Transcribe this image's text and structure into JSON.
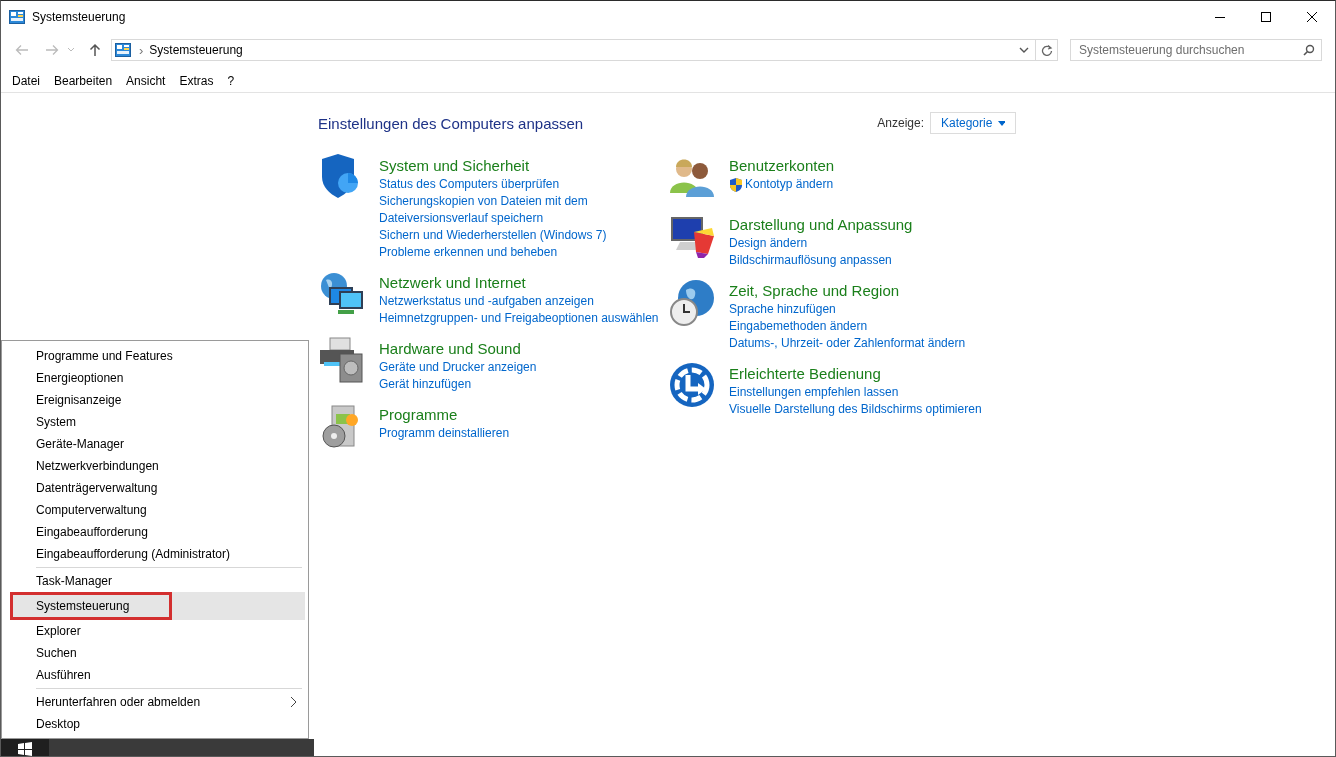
{
  "window": {
    "title": "Systemsteuerung"
  },
  "address_bar": {
    "path": "Systemsteuerung",
    "separator": "›"
  },
  "search": {
    "placeholder": "Systemsteuerung durchsuchen"
  },
  "menu_bar": [
    "Datei",
    "Bearbeiten",
    "Ansicht",
    "Extras",
    "?"
  ],
  "heading": "Einstellungen des Computers anpassen",
  "view": {
    "label": "Anzeige:",
    "value": "Kategorie"
  },
  "columns": [
    [
      {
        "kind": "shield",
        "title": "System und Sicherheit",
        "links": [
          {
            "text": "Status des Computers überprüfen",
            "kind": "plain"
          },
          {
            "text": "Sicherungskopien von Dateien mit dem Dateiversionsverlauf speichern",
            "kind": "plain"
          },
          {
            "text": "Sichern und Wiederherstellen (Windows 7)",
            "kind": "plain"
          },
          {
            "text": "Probleme erkennen und beheben",
            "kind": "plain"
          }
        ]
      },
      {
        "kind": "network",
        "title": "Netzwerk und Internet",
        "links": [
          {
            "text": "Netzwerkstatus und -aufgaben anzeigen",
            "kind": "plain"
          },
          {
            "text": "Heimnetzgruppen- und Freigabeoptionen auswählen",
            "kind": "plain"
          }
        ]
      },
      {
        "kind": "hardware",
        "title": "Hardware und Sound",
        "links": [
          {
            "text": "Geräte und Drucker anzeigen",
            "kind": "plain"
          },
          {
            "text": "Gerät hinzufügen",
            "kind": "plain"
          }
        ]
      },
      {
        "kind": "programs",
        "title": "Programme",
        "links": [
          {
            "text": "Programm deinstallieren",
            "kind": "plain"
          }
        ]
      }
    ],
    [
      {
        "kind": "users",
        "title": "Benutzerkonten",
        "links": [
          {
            "text": "Kontotyp ändern",
            "kind": "admin"
          }
        ]
      },
      {
        "kind": "appearance",
        "title": "Darstellung und Anpassung",
        "links": [
          {
            "text": "Design ändern",
            "kind": "plain"
          },
          {
            "text": "Bildschirmauflösung anpassen",
            "kind": "plain"
          }
        ]
      },
      {
        "kind": "clock",
        "title": "Zeit, Sprache und Region",
        "links": [
          {
            "text": "Sprache hinzufügen",
            "kind": "plain"
          },
          {
            "text": "Eingabemethoden ändern",
            "kind": "plain"
          },
          {
            "text": "Datums-, Uhrzeit- oder Zahlenformat ändern",
            "kind": "plain"
          }
        ]
      },
      {
        "kind": "access",
        "title": "Erleichterte Bedienung",
        "links": [
          {
            "text": "Einstellungen empfehlen lassen",
            "kind": "plain"
          },
          {
            "text": "Visuelle Darstellung des Bildschirms optimieren",
            "kind": "plain"
          }
        ]
      }
    ]
  ],
  "context_menu": {
    "groups": [
      [
        {
          "label": "Programme und Features",
          "selected": false,
          "submenu": false
        },
        {
          "label": "Energieoptionen",
          "selected": false,
          "submenu": false
        },
        {
          "label": "Ereignisanzeige",
          "selected": false,
          "submenu": false
        },
        {
          "label": "System",
          "selected": false,
          "submenu": false
        },
        {
          "label": "Geräte-Manager",
          "selected": false,
          "submenu": false
        },
        {
          "label": "Netzwerkverbindungen",
          "selected": false,
          "submenu": false
        },
        {
          "label": "Datenträgerverwaltung",
          "selected": false,
          "submenu": false
        },
        {
          "label": "Computerverwaltung",
          "selected": false,
          "submenu": false
        },
        {
          "label": "Eingabeaufforderung",
          "selected": false,
          "submenu": false
        },
        {
          "label": "Eingabeaufforderung (Administrator)",
          "selected": false,
          "submenu": false
        }
      ],
      [
        {
          "label": "Task-Manager",
          "selected": false,
          "submenu": false
        },
        {
          "label": "Systemsteuerung",
          "selected": true,
          "submenu": false
        },
        {
          "label": "Explorer",
          "selected": false,
          "submenu": false
        },
        {
          "label": "Suchen",
          "selected": false,
          "submenu": false
        },
        {
          "label": "Ausführen",
          "selected": false,
          "submenu": false
        }
      ],
      [
        {
          "label": "Herunterfahren oder abmelden",
          "selected": false,
          "submenu": true
        },
        {
          "label": "Desktop",
          "selected": false,
          "submenu": false
        }
      ]
    ]
  }
}
